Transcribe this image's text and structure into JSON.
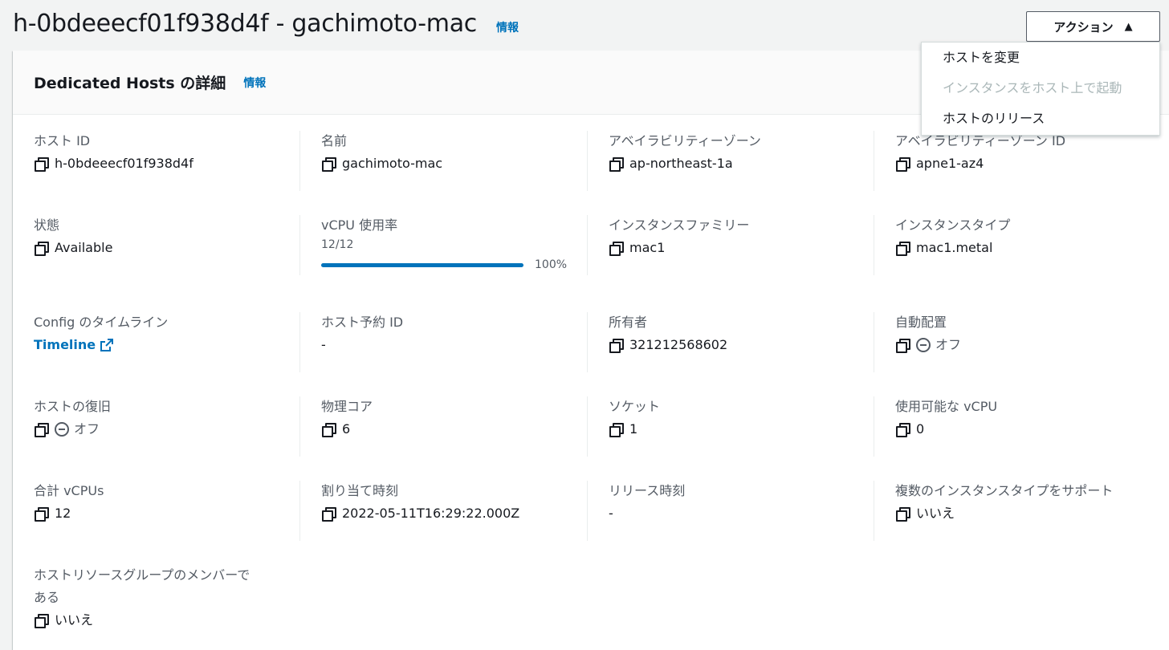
{
  "header": {
    "title": "h-0bdeeecf01f938d4f - gachimoto-mac",
    "info": "情報"
  },
  "actions": {
    "label": "アクション",
    "menu": [
      {
        "label": "ホストを変更",
        "enabled": true
      },
      {
        "label": "インスタンスをホスト上で起動",
        "enabled": false
      },
      {
        "label": "ホストのリリース",
        "enabled": true
      }
    ]
  },
  "panel": {
    "title": "Dedicated Hosts の詳細",
    "info": "情報"
  },
  "details": {
    "host_id": {
      "label": "ホスト ID",
      "value": "h-0bdeeecf01f938d4f"
    },
    "name": {
      "label": "名前",
      "value": "gachimoto-mac"
    },
    "az": {
      "label": "アベイラビリティーゾーン",
      "value": "ap-northeast-1a"
    },
    "az_id": {
      "label": "アベイラビリティーゾーン ID",
      "value": "apne1-az4"
    },
    "state": {
      "label": "状態",
      "value": "Available"
    },
    "vcpu_util": {
      "label": "vCPU 使用率",
      "fraction": "12/12",
      "percent": "100%",
      "percent_value": 100
    },
    "instance_family": {
      "label": "インスタンスファミリー",
      "value": "mac1"
    },
    "instance_type": {
      "label": "インスタンスタイプ",
      "value": "mac1.metal"
    },
    "config_timeline": {
      "label": "Config のタイムライン",
      "value": "Timeline"
    },
    "reservation_id": {
      "label": "ホスト予約 ID",
      "value": "-"
    },
    "owner": {
      "label": "所有者",
      "value": "321212568602"
    },
    "auto_placement": {
      "label": "自動配置",
      "value": "オフ"
    },
    "host_recovery": {
      "label": "ホストの復旧",
      "value": "オフ"
    },
    "physical_cores": {
      "label": "物理コア",
      "value": "6"
    },
    "sockets": {
      "label": "ソケット",
      "value": "1"
    },
    "available_vcpu": {
      "label": "使用可能な vCPU",
      "value": "0"
    },
    "total_vcpus": {
      "label": "合計 vCPUs",
      "value": "12"
    },
    "allocation_time": {
      "label": "割り当て時刻",
      "value": "2022-05-11T16:29:22.000Z"
    },
    "release_time": {
      "label": "リリース時刻",
      "value": "-"
    },
    "multi_type": {
      "label": "複数のインスタンスタイプをサポート",
      "value": "いいえ"
    },
    "resource_group": {
      "label_line1": "ホストリソースグループのメンバーで",
      "label_line2": "ある",
      "value": "いいえ"
    }
  },
  "colors": {
    "accent": "#0073bb",
    "progress_track": "#d5dbdb"
  }
}
